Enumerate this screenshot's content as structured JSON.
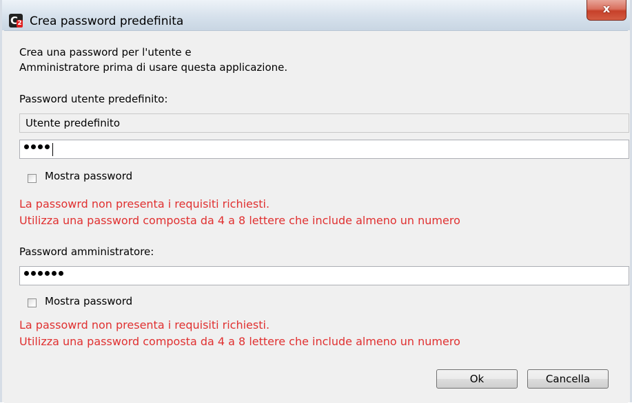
{
  "window": {
    "title": "Crea password predefinita",
    "close_label": "x"
  },
  "intro": {
    "line1": "Crea una password per l'utente e",
    "line2": "Amministratore prima di usare questa applicazione."
  },
  "user_section": {
    "label": "Password utente predefinito:",
    "username_value": "Utente predefinito",
    "password_length": 4,
    "show_password_label": "Mostra password",
    "show_password_checked": false,
    "error_line1": "La passowrd non presenta i requisiti richiesti.",
    "error_line2": "Utilizza una password composta da 4 a 8 lettere che include almeno un numero"
  },
  "admin_section": {
    "label": "Password amministratore:",
    "password_length": 6,
    "show_password_label": "Mostra password",
    "show_password_checked": false,
    "error_line1": "La passowrd non presenta i requisiti richiesti.",
    "error_line2": "Utilizza una password composta da 4 a 8 lettere che include almeno un numero"
  },
  "buttons": {
    "ok_label": "Ok",
    "cancel_label": "Cancella"
  },
  "colors": {
    "error": "#e03030",
    "close_button": "#c6412a"
  }
}
